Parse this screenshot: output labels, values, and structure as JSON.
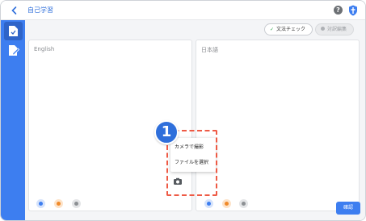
{
  "header": {
    "title": "自己学習",
    "help_label": "?"
  },
  "toolbar": {
    "grammar_check_label": "文法チェック",
    "compare_edit_label": "対訳編集"
  },
  "panels": {
    "source_label": "English",
    "target_label": "日本語"
  },
  "menu": {
    "items": [
      "カメラで撮影",
      "ファイルを選択"
    ]
  },
  "callout": {
    "number": "1"
  },
  "footer": {
    "confirm_label": "確認"
  },
  "colors": {
    "accent": "#3d7ef0",
    "callout_border": "#ee5a45",
    "grammar_check": "#2fa84f"
  }
}
